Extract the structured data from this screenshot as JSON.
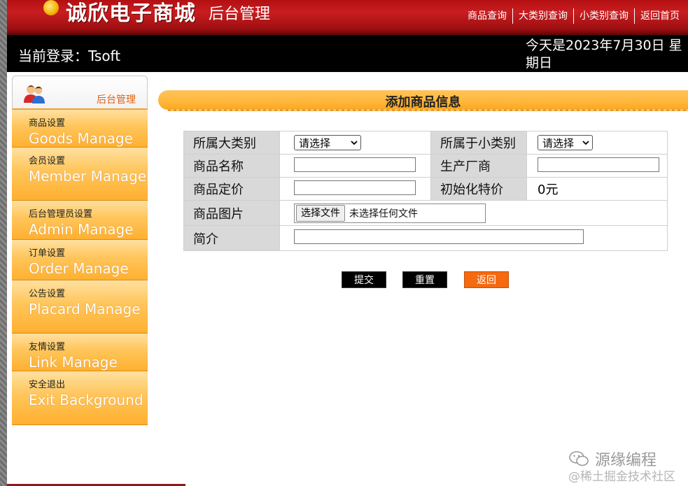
{
  "header": {
    "logo_title": "诚欣电子商城",
    "logo_subtitle": "后台管理",
    "nav": [
      "商品查询",
      "大类别查询",
      "小类别查询",
      "返回首页"
    ]
  },
  "infobar": {
    "login_text": "当前登录：Tsoft",
    "date_text": "今天是2023年7月30日 星期日"
  },
  "sidebar": {
    "header_label": "后台管理",
    "groups": [
      {
        "category": "商品设置",
        "link": "Goods Manage"
      },
      {
        "category": "会员设置",
        "link": "Member Manage"
      },
      {
        "category": "后台管理员设置",
        "link": "Admin Manage"
      },
      {
        "category": "订单设置",
        "link": "Order Manage"
      },
      {
        "category": "公告设置",
        "link": "Placard Manage"
      },
      {
        "category": "友情设置",
        "link": "Link Manage"
      },
      {
        "category": "安全退出",
        "link": "Exit Background"
      }
    ]
  },
  "main": {
    "title": "添加商品信息",
    "form": {
      "big_category_label": "所属大类别",
      "big_category_value": "请选择",
      "small_category_label": "所属于小类别",
      "small_category_value": "请选择",
      "name_label": "商品名称",
      "maker_label": "生产厂商",
      "price_label": "商品定价",
      "special_price_label": "初始化特价",
      "special_price_value": "0元",
      "image_label": "商品图片",
      "file_button": "选择文件",
      "file_status": "未选择任何文件",
      "intro_label": "简介"
    },
    "buttons": {
      "submit": "提交",
      "reset": "重置",
      "back": "返回"
    }
  },
  "watermark": {
    "line1": "源缘编程",
    "line2": "@稀土掘金技术社区"
  }
}
